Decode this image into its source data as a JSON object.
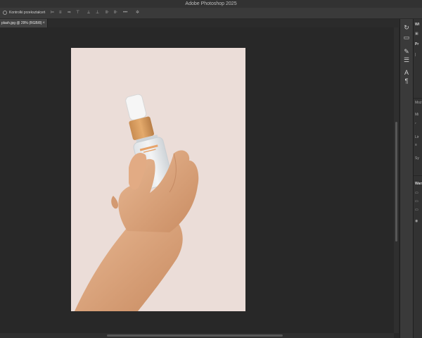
{
  "app": {
    "title": "Adobe Photoshop 2025"
  },
  "options_bar": {
    "checkbox_label": "Kontrolki przekształceń",
    "icons": [
      "align-left-icon",
      "align-center-icon",
      "align-right-icon",
      "align-top-icon",
      "align-middle-icon",
      "align-bottom-icon",
      "distribute-icon",
      "more-icon",
      "gear-icon"
    ]
  },
  "document_tab": {
    "label": "plash.jpg @ 29% (RGB/8)",
    "close": "×"
  },
  "right_panel": {
    "header_top": "Wł",
    "header_props": "Pr",
    "header_layers": "Wars",
    "rows": [
      "Moż",
      "Mi",
      "Lir",
      "Sy"
    ]
  },
  "toolstrip": {
    "icons": [
      "history-icon",
      "comment-icon",
      "brush-settings-icon",
      "adjustments-icon",
      "character-icon",
      "paragraph-icon"
    ]
  },
  "colors": {
    "document_bg": "#ebddd8",
    "workspace_bg": "#282828",
    "pump_accent": "#d79c5c"
  }
}
